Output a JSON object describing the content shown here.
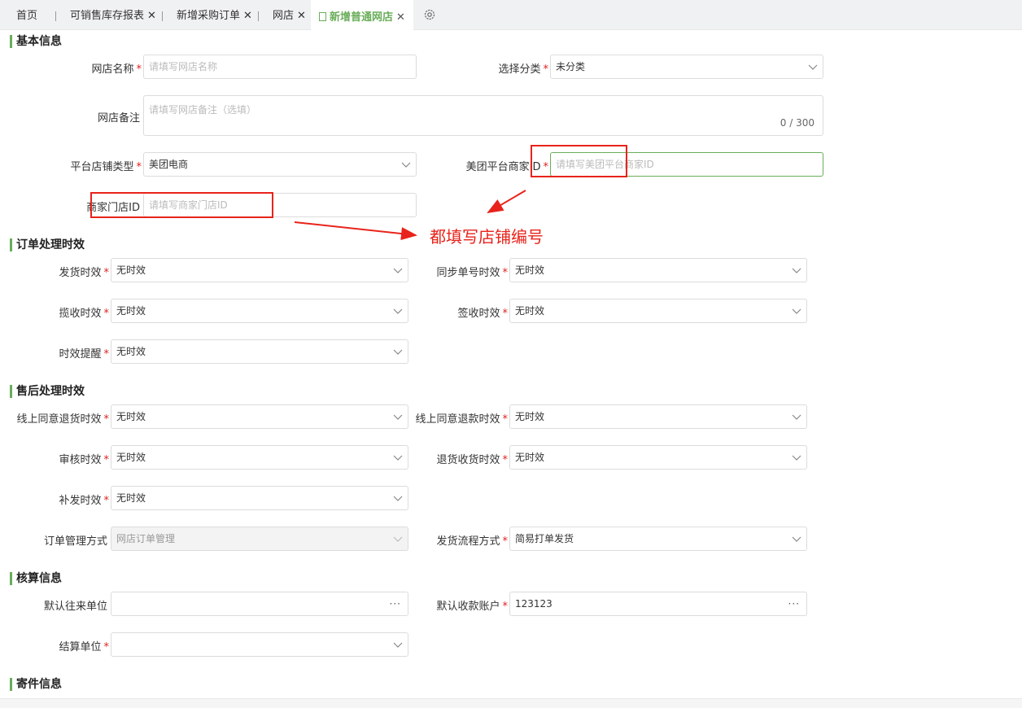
{
  "tabs": [
    {
      "label": "首页"
    },
    {
      "label": "可销售库存报表",
      "close": "✕"
    },
    {
      "label": "新增采购订单",
      "close": "✕"
    },
    {
      "label": "网店",
      "close": "✕"
    },
    {
      "label": "新增普通网店",
      "close": "✕"
    }
  ],
  "sections": {
    "basic": "基本信息",
    "order_timing": "订单处理时效",
    "after_sale": "售后处理时效",
    "accounting": "核算信息",
    "shipping": "寄件信息"
  },
  "basic": {
    "shop_name": {
      "label": "网店名称",
      "placeholder": "请填写网店名称"
    },
    "category": {
      "label": "选择分类",
      "value": "未分类"
    },
    "remark": {
      "label": "网店备注",
      "placeholder": "请填写网店备注（选填）",
      "counter": "0 / 300"
    },
    "platform_type": {
      "label": "平台店铺类型",
      "value": "美团电商"
    },
    "merchant_id": {
      "label": "美团平台商家ID",
      "placeholder": "请填写美团平台商家ID"
    },
    "store_id": {
      "label": "商家门店ID",
      "placeholder": "请填写商家门店ID"
    }
  },
  "annotation": "都填写店铺编号",
  "order_timing": {
    "ship": {
      "label": "发货时效",
      "value": "无时效"
    },
    "sync": {
      "label": "同步单号时效",
      "value": "无时效"
    },
    "pickup": {
      "label": "揽收时效",
      "value": "无时效"
    },
    "sign": {
      "label": "签收时效",
      "value": "无时效"
    },
    "remind": {
      "label": "时效提醒",
      "value": "无时效"
    }
  },
  "after_sale": {
    "return_agree": {
      "label": "线上同意退货时效",
      "value": "无时效"
    },
    "refund_agree": {
      "label": "线上同意退款时效",
      "value": "无时效"
    },
    "audit": {
      "label": "审核时效",
      "value": "无时效"
    },
    "return_receive": {
      "label": "退货收货时效",
      "value": "无时效"
    },
    "reissue": {
      "label": "补发时效",
      "value": "无时效"
    },
    "order_mgmt": {
      "label": "订单管理方式",
      "value": "网店订单管理"
    },
    "ship_flow": {
      "label": "发货流程方式",
      "value": "简易打单发货"
    }
  },
  "accounting": {
    "default_unit": {
      "label": "默认往来单位",
      "value": ""
    },
    "default_account": {
      "label": "默认收款账户",
      "value": "123123"
    },
    "settle_unit": {
      "label": "结算单位",
      "value": ""
    }
  },
  "icons": {
    "dots": "···",
    "required": "*"
  },
  "colors": {
    "accent": "#6aad5a",
    "annotation": "#e8231b"
  }
}
